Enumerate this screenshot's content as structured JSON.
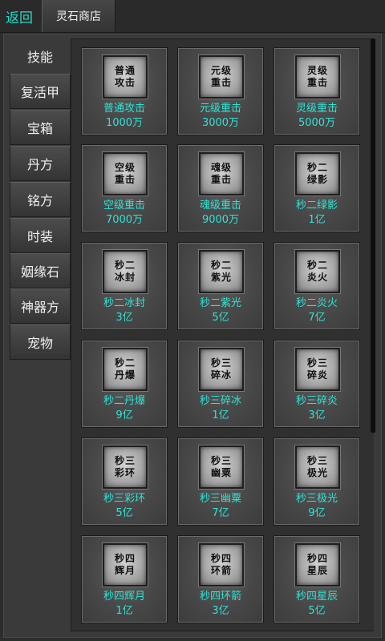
{
  "header": {
    "back_label": "返回",
    "tab_label": "灵石商店"
  },
  "sidebar": {
    "items": [
      {
        "label": "技能",
        "active": true
      },
      {
        "label": "复活甲"
      },
      {
        "label": "宝箱"
      },
      {
        "label": "丹方"
      },
      {
        "label": "铭方"
      },
      {
        "label": "时装"
      },
      {
        "label": "姻缘石"
      },
      {
        "label": "神器方"
      },
      {
        "label": "宠物"
      }
    ]
  },
  "items": [
    {
      "icon_line1": "普通",
      "icon_line2": "攻击",
      "name": "普通攻击",
      "price": "1000万"
    },
    {
      "icon_line1": "元级",
      "icon_line2": "重击",
      "name": "元级重击",
      "price": "3000万"
    },
    {
      "icon_line1": "灵级",
      "icon_line2": "重击",
      "name": "灵级重击",
      "price": "5000万"
    },
    {
      "icon_line1": "空级",
      "icon_line2": "重击",
      "name": "空级重击",
      "price": "7000万"
    },
    {
      "icon_line1": "魂级",
      "icon_line2": "重击",
      "name": "魂级重击",
      "price": "9000万"
    },
    {
      "icon_line1": "秒二",
      "icon_line2": "绿影",
      "name": "秒二绿影",
      "price": "1亿"
    },
    {
      "icon_line1": "秒二",
      "icon_line2": "冰封",
      "name": "秒二冰封",
      "price": "3亿"
    },
    {
      "icon_line1": "秒二",
      "icon_line2": "紫光",
      "name": "秒二紫光",
      "price": "5亿"
    },
    {
      "icon_line1": "秒二",
      "icon_line2": "炎火",
      "name": "秒二炎火",
      "price": "7亿"
    },
    {
      "icon_line1": "秒二",
      "icon_line2": "丹爆",
      "name": "秒二丹爆",
      "price": "9亿"
    },
    {
      "icon_line1": "秒三",
      "icon_line2": "碎冰",
      "name": "秒三碎冰",
      "price": "1亿"
    },
    {
      "icon_line1": "秒三",
      "icon_line2": "碎炎",
      "name": "秒三碎炎",
      "price": "3亿"
    },
    {
      "icon_line1": "秒三",
      "icon_line2": "彩环",
      "name": "秒三彩环",
      "price": "5亿"
    },
    {
      "icon_line1": "秒三",
      "icon_line2": "幽粟",
      "name": "秒三幽粟",
      "price": "7亿"
    },
    {
      "icon_line1": "秒三",
      "icon_line2": "极光",
      "name": "秒三极光",
      "price": "9亿"
    },
    {
      "icon_line1": "秒四",
      "icon_line2": "辉月",
      "name": "秒四辉月",
      "price": "1亿"
    },
    {
      "icon_line1": "秒四",
      "icon_line2": "环箭",
      "name": "秒四环箭",
      "price": "3亿"
    },
    {
      "icon_line1": "秒四",
      "icon_line2": "星辰",
      "name": "秒四星辰",
      "price": "5亿"
    }
  ],
  "colors": {
    "accent": "#2fe3d6",
    "back_text": "#26d9c8"
  }
}
